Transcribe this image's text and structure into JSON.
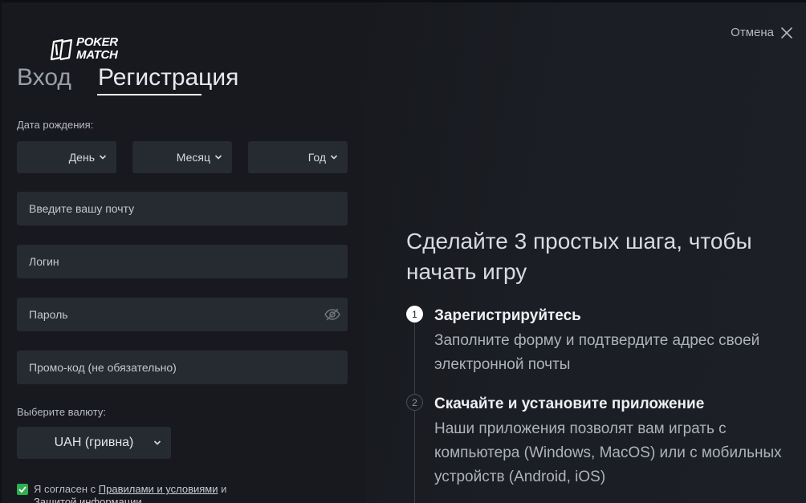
{
  "logo": {
    "line1": "POKER",
    "line2": "MATCH"
  },
  "tabs": {
    "login": "Вход",
    "register": "Регистрация"
  },
  "cancel": {
    "label": "Отмена"
  },
  "form": {
    "birth_label": "Дата рождения:",
    "day": "День",
    "month": "Месяц",
    "year": "Год",
    "email_placeholder": "Введите вашу почту",
    "login_placeholder": "Логин",
    "password_placeholder": "Пароль",
    "promo_placeholder": "Промо-код (не обязательно)",
    "currency_label": "Выберите валюту:",
    "currency_value": "UAH (гривна)",
    "agree_prefix": "Я согласен с ",
    "agree_link1": "Правилами и условиями",
    "agree_mid": " и ",
    "agree_link2": "Защитой информации"
  },
  "promo": {
    "headline": "Сделайте 3 простых шага, чтобы начать игру",
    "steps": [
      {
        "num": "1",
        "title": "Зарегистрируйтесь",
        "desc": "Заполните форму и подтвердите адрес своей электронной почты"
      },
      {
        "num": "2",
        "title": "Скачайте и установите приложение",
        "desc": "Наши приложения позволят вам играть с компьютера (Windows, MacOS) или с мобильных устройств (Android, iOS)"
      }
    ]
  },
  "colors": {
    "background": "#17191e",
    "field": "#262a31",
    "checkbox": "#2fae4d",
    "text": "#c9ced6"
  },
  "icons": {
    "close": "close-icon",
    "chevron": "chevron-down-icon",
    "eye": "eye-off-icon",
    "check": "check-icon"
  }
}
